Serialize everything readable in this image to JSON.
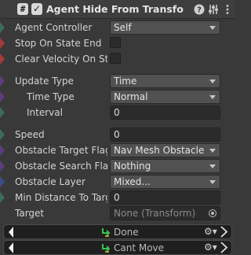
{
  "header": {
    "title": "Agent Hide From Transfo",
    "script_icon": "#",
    "enabled_check": "✓",
    "icons": [
      "help-icon",
      "preset-icon",
      "menu-icon"
    ]
  },
  "fields": {
    "agent_controller": {
      "label": "Agent Controller",
      "value": "Self"
    },
    "stop_on_state_end": {
      "label": "Stop On State End"
    },
    "clear_velocity": {
      "label": "Clear Velocity On Sto"
    },
    "update_type": {
      "label": "Update Type",
      "value": "Time"
    },
    "time_type": {
      "label": "Time Type",
      "value": "Normal"
    },
    "interval": {
      "label": "Interval",
      "value": "0"
    },
    "speed": {
      "label": "Speed",
      "value": "0"
    },
    "obstacle_target_flags": {
      "label": "Obstacle Target Flag:",
      "value": "Nav Mesh Obstacle"
    },
    "obstacle_search_flags": {
      "label": "Obstacle Search Flag",
      "value": "Nothing"
    },
    "obstacle_layer": {
      "label": "Obstacle Layer",
      "value": "Mixed..."
    },
    "min_distance": {
      "label": "Min Distance To Targ",
      "value": "0"
    },
    "target": {
      "label": "Target",
      "value": "None (Transform)"
    }
  },
  "transitions": [
    {
      "label": "Done"
    },
    {
      "label": "Cant Move"
    }
  ],
  "colors": {
    "background": "#393939",
    "marker_red": "#a63a3a",
    "marker_blue": "#3b4e88",
    "marker_purple": "#5d3d7d",
    "marker_teal": "#3c6b62",
    "transition_icon": "#3fbf4f"
  }
}
